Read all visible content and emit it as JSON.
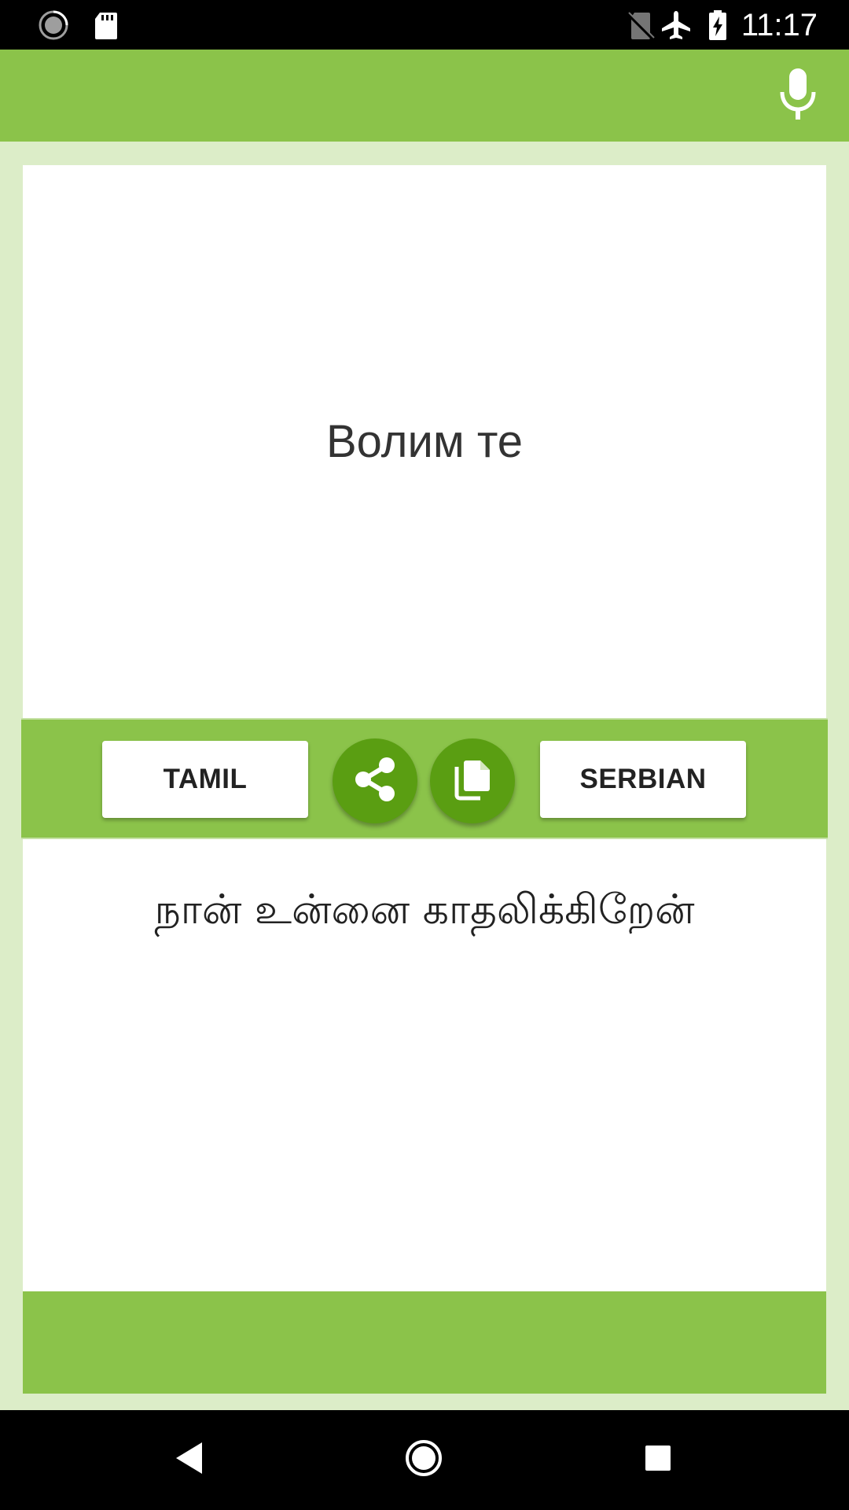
{
  "status_bar": {
    "time": "11:17",
    "left_icons": [
      "sync-icon",
      "sd-card-icon"
    ],
    "right_icons": [
      "no-sim-icon",
      "airplane-mode-icon",
      "battery-charging-icon"
    ]
  },
  "app_bar": {
    "mic_icon": "microphone-icon"
  },
  "source": {
    "text": "Волим те"
  },
  "controls": {
    "source_language": "TAMIL",
    "target_language": "SERBIAN",
    "share_icon": "share-icon",
    "copy_icon": "copy-icon"
  },
  "target": {
    "text": "நான் உன்னை காதலிக்கிறேன்"
  },
  "colors": {
    "primary": "#8bc34a",
    "primary_light": "#dcedc8",
    "action": "#5a9e12"
  },
  "nav_bar": {
    "back_icon": "back-icon",
    "home_icon": "home-icon",
    "recents_icon": "recents-icon"
  }
}
